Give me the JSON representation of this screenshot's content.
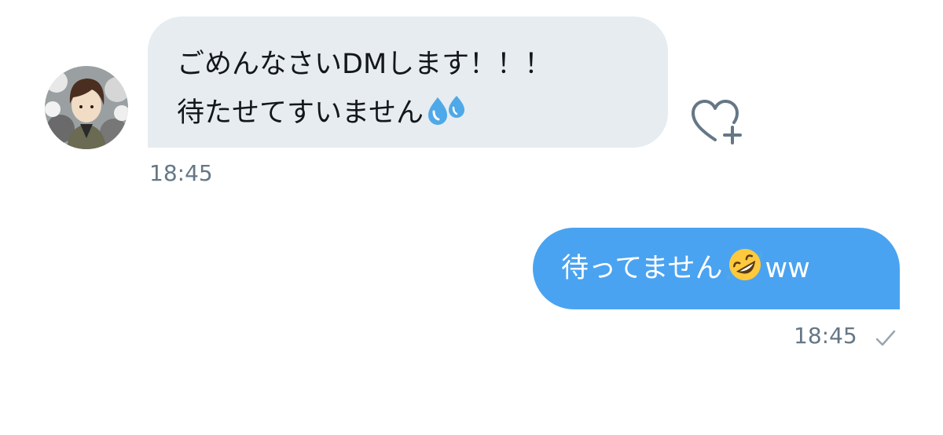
{
  "conversation": {
    "incoming": {
      "lines": [
        "ごめんなさいDMします！！！",
        "待たせてすいません"
      ],
      "emoji": "sweat-droplets",
      "timestamp": "18:45",
      "bubble_color": "#e6ecf0"
    },
    "outgoing": {
      "text": "待ってません",
      "emoji": "rolling-on-floor-laughing",
      "suffix": "ww",
      "timestamp": "18:45",
      "read_status": "checkmark",
      "bubble_color": "#4aa3f0"
    },
    "reaction_button": "heart-plus-icon"
  },
  "colors": {
    "background": "#ffffff",
    "timestamp": "#657786",
    "icon_gray": "#657786",
    "text_dark": "#14171a"
  }
}
